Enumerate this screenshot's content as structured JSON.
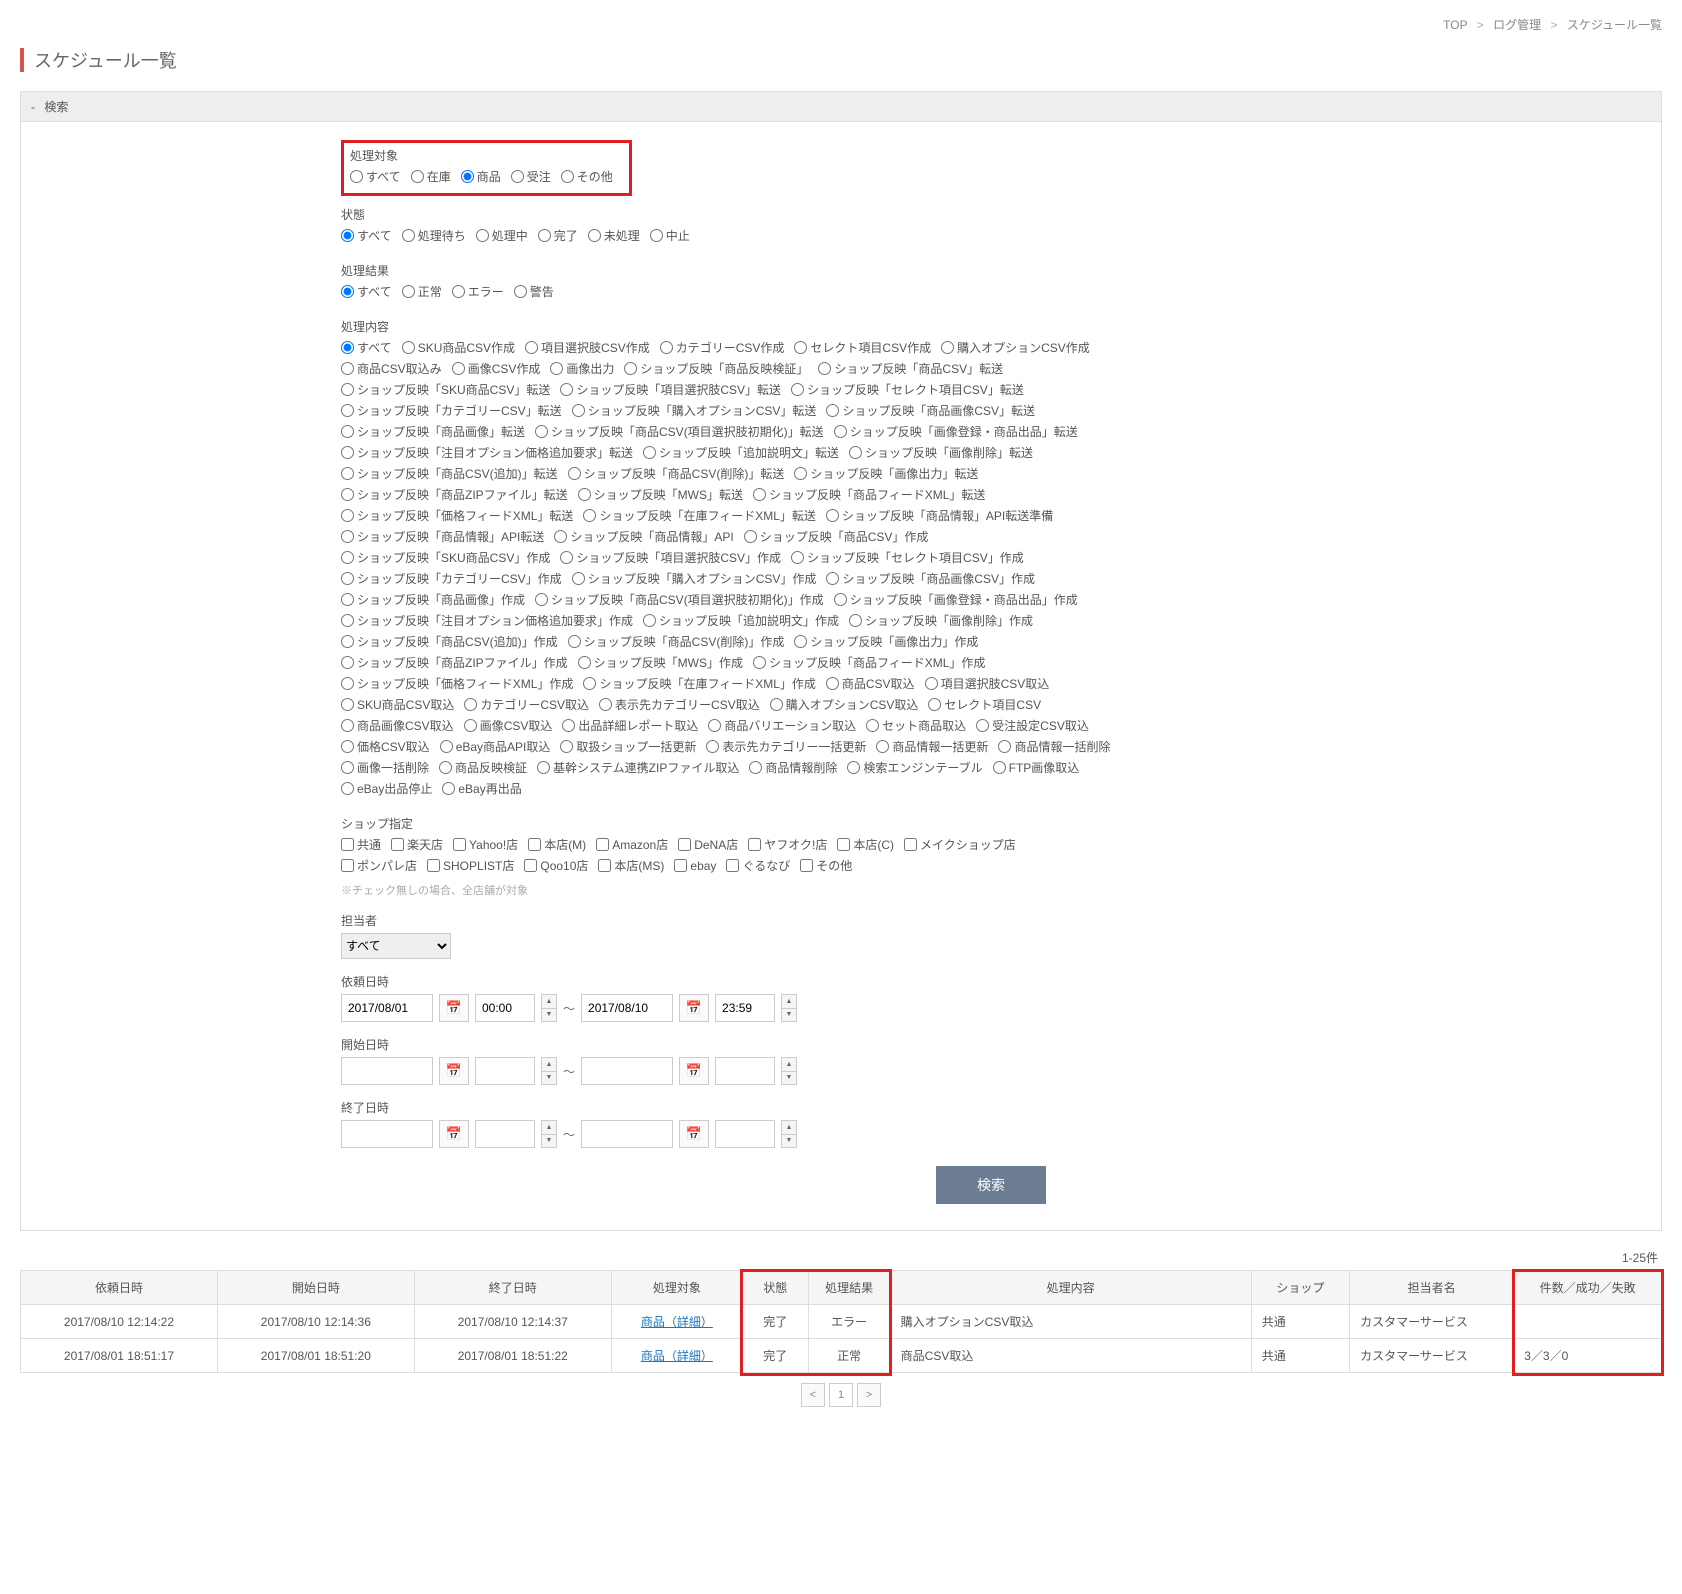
{
  "breadcrumb": {
    "top": "TOP",
    "log": "ログ管理",
    "current": "スケジュール一覧"
  },
  "page_title": "スケジュール一覧",
  "panel_header": {
    "dash": "-",
    "label": "検索"
  },
  "target": {
    "label": "処理対象",
    "options": [
      "すべて",
      "在庫",
      "商品",
      "受注",
      "その他"
    ],
    "selected": "商品"
  },
  "status": {
    "label": "状態",
    "options": [
      "すべて",
      "処理待ち",
      "処理中",
      "完了",
      "未処理",
      "中止"
    ],
    "selected": "すべて"
  },
  "result": {
    "label": "処理結果",
    "options": [
      "すべて",
      "正常",
      "エラー",
      "警告"
    ],
    "selected": "すべて"
  },
  "content": {
    "label": "処理内容",
    "selected": "すべて",
    "options": [
      "すべて",
      "SKU商品CSV作成",
      "項目選択肢CSV作成",
      "カテゴリーCSV作成",
      "セレクト項目CSV作成",
      "購入オプションCSV作成",
      "商品CSV取込み",
      "画像CSV作成",
      "画像出力",
      "ショップ反映「商品反映検証」",
      "ショップ反映「商品CSV」転送",
      "ショップ反映「SKU商品CSV」転送",
      "ショップ反映「項目選択肢CSV」転送",
      "ショップ反映「セレクト項目CSV」転送",
      "ショップ反映「カテゴリーCSV」転送",
      "ショップ反映「購入オプションCSV」転送",
      "ショップ反映「商品画像CSV」転送",
      "ショップ反映「商品画像」転送",
      "ショップ反映「商品CSV(項目選択肢初期化)」転送",
      "ショップ反映「画像登録・商品出品」転送",
      "ショップ反映「注目オプション価格追加要求」転送",
      "ショップ反映「追加説明文」転送",
      "ショップ反映「画像削除」転送",
      "ショップ反映「商品CSV(追加)」転送",
      "ショップ反映「商品CSV(削除)」転送",
      "ショップ反映「画像出力」転送",
      "ショップ反映「商品ZIPファイル」転送",
      "ショップ反映「MWS」転送",
      "ショップ反映「商品フィードXML」転送",
      "ショップ反映「価格フィードXML」転送",
      "ショップ反映「在庫フィードXML」転送",
      "ショップ反映「商品情報」API転送準備",
      "ショップ反映「商品情報」API転送",
      "ショップ反映「商品情報」API",
      "ショップ反映「商品CSV」作成",
      "ショップ反映「SKU商品CSV」作成",
      "ショップ反映「項目選択肢CSV」作成",
      "ショップ反映「セレクト項目CSV」作成",
      "ショップ反映「カテゴリーCSV」作成",
      "ショップ反映「購入オプションCSV」作成",
      "ショップ反映「商品画像CSV」作成",
      "ショップ反映「商品画像」作成",
      "ショップ反映「商品CSV(項目選択肢初期化)」作成",
      "ショップ反映「画像登録・商品出品」作成",
      "ショップ反映「注目オプション価格追加要求」作成",
      "ショップ反映「追加説明文」作成",
      "ショップ反映「画像削除」作成",
      "ショップ反映「商品CSV(追加)」作成",
      "ショップ反映「商品CSV(削除)」作成",
      "ショップ反映「画像出力」作成",
      "ショップ反映「商品ZIPファイル」作成",
      "ショップ反映「MWS」作成",
      "ショップ反映「商品フィードXML」作成",
      "ショップ反映「価格フィードXML」作成",
      "ショップ反映「在庫フィードXML」作成",
      "商品CSV取込",
      "項目選択肢CSV取込",
      "SKU商品CSV取込",
      "カテゴリーCSV取込",
      "表示先カテゴリーCSV取込",
      "購入オプションCSV取込",
      "セレクト項目CSV",
      "商品画像CSV取込",
      "画像CSV取込",
      "出品詳細レポート取込",
      "商品バリエーション取込",
      "セット商品取込",
      "受注設定CSV取込",
      "価格CSV取込",
      "eBay商品API取込",
      "取扱ショップ一括更新",
      "表示先カテゴリー一括更新",
      "商品情報一括更新",
      "商品情報一括削除",
      "画像一括削除",
      "商品反映検証",
      "基幹システム連携ZIPファイル取込",
      "商品情報削除",
      "検索エンジンテーブル",
      "FTP画像取込",
      "eBay出品停止",
      "eBay再出品"
    ]
  },
  "shops": {
    "label": "ショップ指定",
    "options": [
      "共通",
      "楽天店",
      "Yahoo!店",
      "本店(M)",
      "Amazon店",
      "DeNA店",
      "ヤフオク!店",
      "本店(C)",
      "メイクショップ店",
      "ポンパレ店",
      "SHOPLIST店",
      "Qoo10店",
      "本店(MS)",
      "ebay",
      "ぐるなび",
      "その他"
    ],
    "note": "※チェック無しの場合、全店舗が対象"
  },
  "assignee": {
    "label": "担当者",
    "selected": "すべて"
  },
  "dates": {
    "request": {
      "label": "依頼日時",
      "from_d": "2017/08/01",
      "from_t": "00:00",
      "to_d": "2017/08/10",
      "to_t": "23:59"
    },
    "start": {
      "label": "開始日時",
      "from_d": "",
      "from_t": "",
      "to_d": "",
      "to_t": ""
    },
    "end": {
      "label": "終了日時",
      "from_d": "",
      "from_t": "",
      "to_d": "",
      "to_t": ""
    }
  },
  "search_button": "検索",
  "result_count": "1-25件",
  "table": {
    "headers": [
      "依頼日時",
      "開始日時",
      "終了日時",
      "処理対象",
      "状態",
      "処理結果",
      "処理内容",
      "ショップ",
      "担当者名",
      "件数／成功／失敗"
    ],
    "rows": [
      {
        "req": "2017/08/10 12:14:22",
        "start": "2017/08/10 12:14:36",
        "end": "2017/08/10 12:14:37",
        "target": "商品（詳細）",
        "status": "完了",
        "result": "エラー",
        "content": "購入オプションCSV取込",
        "shop": "共通",
        "assignee": "カスタマーサービス",
        "counts": ""
      },
      {
        "req": "2017/08/01 18:51:17",
        "start": "2017/08/01 18:51:20",
        "end": "2017/08/01 18:51:22",
        "target": "商品（詳細）",
        "status": "完了",
        "result": "正常",
        "content": "商品CSV取込",
        "shop": "共通",
        "assignee": "カスタマーサービス",
        "counts": "3／3／0"
      }
    ]
  },
  "pager": {
    "prev": "<",
    "current": "1",
    "next": ">"
  }
}
